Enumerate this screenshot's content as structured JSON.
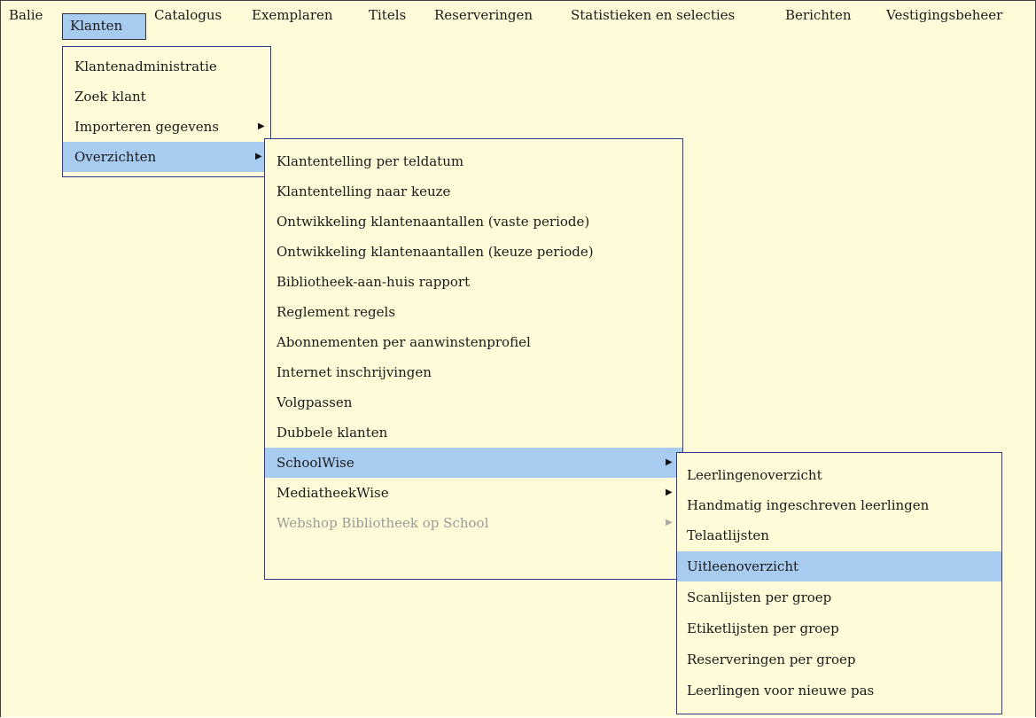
{
  "menubar": {
    "items": [
      {
        "label": "Balie"
      },
      {
        "label": "Klanten"
      },
      {
        "label": "Catalogus"
      },
      {
        "label": "Exemplaren"
      },
      {
        "label": "Titels"
      },
      {
        "label": "Reserveringen"
      },
      {
        "label": "Statistieken en selecties"
      },
      {
        "label": "Berichten"
      },
      {
        "label": "Vestigingsbeheer"
      }
    ]
  },
  "klanten_menu": {
    "items": [
      {
        "label": "Klantenadministratie"
      },
      {
        "label": "Zoek klant"
      },
      {
        "label": "Importeren gegevens"
      },
      {
        "label": "Overzichten"
      }
    ]
  },
  "overzichten_menu": {
    "items": [
      {
        "label": "Klantentelling per teldatum"
      },
      {
        "label": "Klantentelling naar keuze"
      },
      {
        "label": "Ontwikkeling klantenaantallen (vaste periode)"
      },
      {
        "label": "Ontwikkeling klantenaantallen (keuze periode)"
      },
      {
        "label": "Bibliotheek-aan-huis rapport"
      },
      {
        "label": "Reglement regels"
      },
      {
        "label": "Abonnementen per aanwinstenprofiel"
      },
      {
        "label": "Internet inschrijvingen"
      },
      {
        "label": "Volgpassen"
      },
      {
        "label": "Dubbele klanten"
      },
      {
        "label": "SchoolWise"
      },
      {
        "label": "MediatheekWise"
      },
      {
        "label": "Webshop Bibliotheek op School"
      }
    ]
  },
  "schoolwise_menu": {
    "items": [
      {
        "label": "Leerlingenoverzicht"
      },
      {
        "label": "Handmatig ingeschreven leerlingen"
      },
      {
        "label": "Telaatlijsten"
      },
      {
        "label": "Uitleenoverzicht"
      },
      {
        "label": "Scanlijsten per groep"
      },
      {
        "label": "Etiketlijsten per groep"
      },
      {
        "label": "Reserveringen per groep"
      },
      {
        "label": "Leerlingen voor nieuwe pas"
      }
    ]
  },
  "colors": {
    "background": "#fffbd8",
    "highlight": "#a8ccf0",
    "menu_border": "#2b3a8f",
    "disabled_text": "#9a9a9a"
  },
  "icons": {
    "submenu_arrow": "triangle-right-icon"
  }
}
